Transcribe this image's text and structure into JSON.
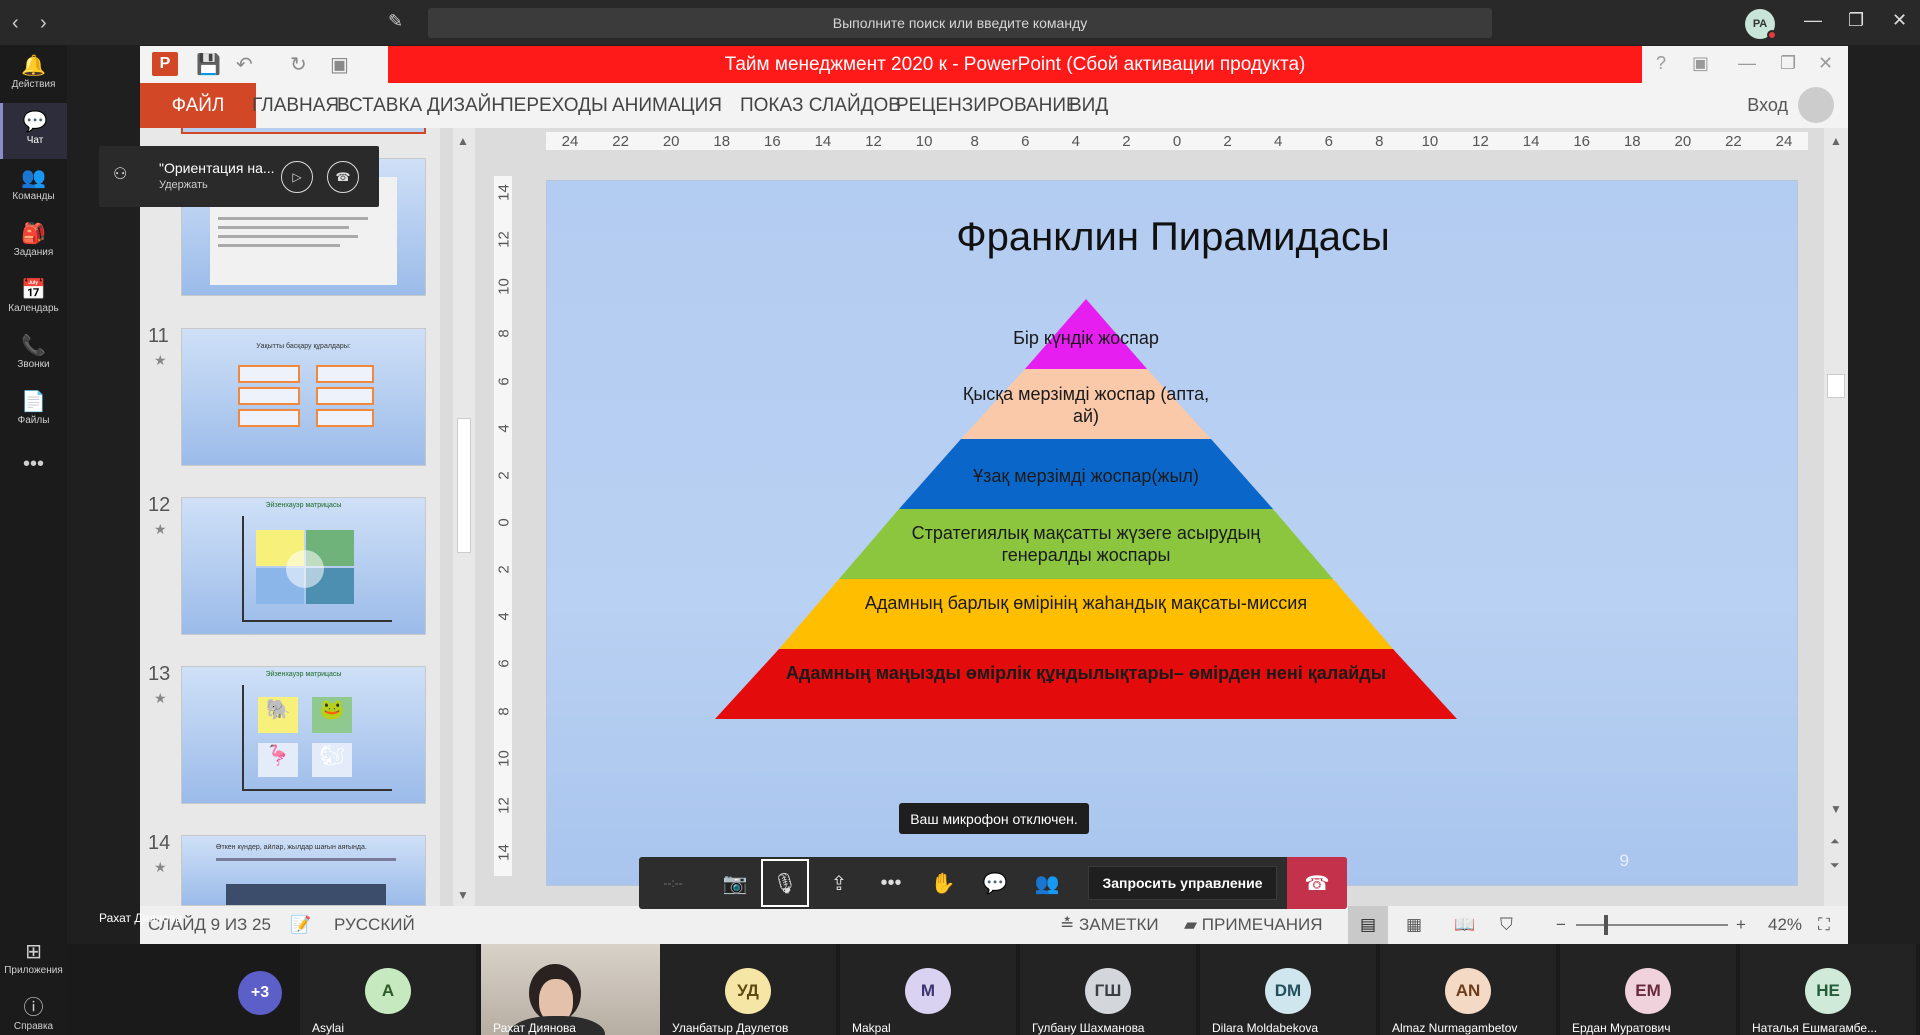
{
  "teams": {
    "search_placeholder": "Выполните поиск или введите команду",
    "user_initials": "РА",
    "rail": [
      {
        "label": "Действия",
        "icon": "bell-icon",
        "glyph": "🔔"
      },
      {
        "label": "Чат",
        "icon": "chat-icon",
        "glyph": "💬"
      },
      {
        "label": "Команды",
        "icon": "teams-icon",
        "glyph": "👥"
      },
      {
        "label": "Задания",
        "icon": "assignments-icon",
        "glyph": "🎒"
      },
      {
        "label": "Календарь",
        "icon": "calendar-icon",
        "glyph": "📅"
      },
      {
        "label": "Звонки",
        "icon": "phone-icon",
        "glyph": "📞"
      },
      {
        "label": "Файлы",
        "icon": "files-icon",
        "glyph": "📄"
      }
    ],
    "rail_more": "•••",
    "apps_label": "Приложения",
    "help_label": "Справка"
  },
  "ppt": {
    "logo": "P",
    "title": "Тайм менеджмент 2020 к -  PowerPoint (Сбой активации продукта)",
    "tabs": [
      "ФАЙЛ",
      "ГЛАВНАЯ",
      "ВСТАВКА",
      "ДИЗАЙН",
      "ПЕРЕХОДЫ",
      "АНИМАЦИЯ",
      "ПОКАЗ СЛАЙДОВ",
      "РЕЦЕНЗИРОВАНИЕ",
      "ВИД"
    ],
    "signin": "Вход",
    "thumbs": [
      {
        "num": "11",
        "type": "boxes",
        "header": "Уақытты басқару құралдары:"
      },
      {
        "num": "12",
        "type": "matrix",
        "header": "Эйзенхауэр матрицасы"
      },
      {
        "num": "13",
        "type": "matrix-pics",
        "header": "Эйзенхауэр матрицасы"
      },
      {
        "num": "14",
        "type": "text",
        "header": "Өткен күндер, айлар, жылдар шағын аяғында."
      }
    ],
    "ruler_h": [
      "24",
      "22",
      "20",
      "18",
      "16",
      "14",
      "12",
      "10",
      "8",
      "6",
      "4",
      "2",
      "0",
      "2",
      "4",
      "6",
      "8",
      "10",
      "12",
      "14",
      "16",
      "18",
      "20",
      "22",
      "24"
    ],
    "ruler_v": [
      "14",
      "12",
      "10",
      "8",
      "6",
      "4",
      "2",
      "0",
      "2",
      "4",
      "6",
      "8",
      "10",
      "12",
      "14"
    ],
    "slide": {
      "title": "Франклин Пирамидасы",
      "number": "9",
      "levels": [
        {
          "text": "Бір күндік жоспар",
          "color": "#e61ef0"
        },
        {
          "text": "Қысқа мерзімді жоспар (апта, ай)",
          "color": "#f9c9a9"
        },
        {
          "text": "Ұзақ мерзімді жоспар(жыл)",
          "color": "#0b66c9"
        },
        {
          "text": "Стратегиялық мақсатты жүзеге асырудың генералды  жоспары",
          "color": "#8cc63f"
        },
        {
          "text": "Адамның барлық өмірінің жаһандық мақсаты-миссия",
          "color": "#ffbf00"
        },
        {
          "text": "Адамның маңызды өмірлік құндылықтары– өмірден нені қалайды",
          "color": "#e30b0b"
        }
      ]
    },
    "status": {
      "slide_info": "СЛАЙД 9 ИЗ 25",
      "language": "РУССКИЙ",
      "notes": "ЗАМЕТКИ",
      "comments": "ПРИМЕЧАНИЯ",
      "zoom": "42%"
    }
  },
  "call": {
    "notification": {
      "title": "\"Ориентация на...",
      "subtitle": "Удержать"
    },
    "mic_tooltip": "Ваш микрофон отключен.",
    "timer": "--:--",
    "request_control": "Запросить управление",
    "presenter": "Рахат Диянова",
    "more_count": "+3",
    "participants": [
      {
        "name": "Asylai",
        "initials": "A",
        "bg": "#c7e9c0",
        "fg": "#2f5b2a"
      },
      {
        "name": "Уланбатыр Даулетов",
        "initials": "УД",
        "bg": "#f6e6a6",
        "fg": "#5c4a12"
      },
      {
        "name": "Makpal",
        "initials": "M",
        "bg": "#d9d2f0",
        "fg": "#3c3470"
      },
      {
        "name": "Гулбану Шахманова",
        "initials": "ГШ",
        "bg": "#d3d7dc",
        "fg": "#3a3f45"
      },
      {
        "name": "Dilara Moldabekova",
        "initials": "DM",
        "bg": "#cfe6ef",
        "fg": "#24505e"
      },
      {
        "name": "Almaz Nurmagambetov",
        "initials": "AN",
        "bg": "#f4d9c4",
        "fg": "#6b3b1d"
      },
      {
        "name": "Ердан Муратович",
        "initials": "ЕМ",
        "bg": "#f0d2dc",
        "fg": "#6a2a3e"
      },
      {
        "name": "Наталья Ешмагамбе...",
        "initials": "НЕ",
        "bg": "#cfead8",
        "fg": "#245c3a"
      }
    ]
  }
}
